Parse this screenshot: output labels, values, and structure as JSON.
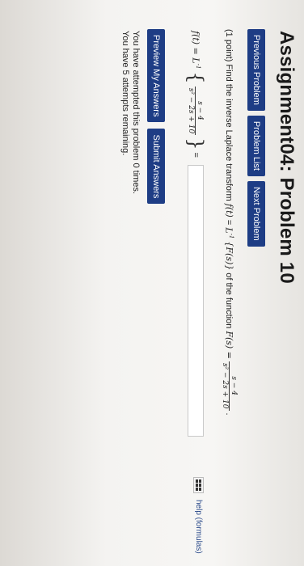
{
  "title": "Assignment04: Problem 10",
  "nav": {
    "previous": "Previous Problem",
    "list": "Problem List",
    "next": "Next Problem"
  },
  "problem": {
    "points": "(1 point)",
    "text": "Find the inverse Laplace transform",
    "ft": "f(t)",
    "equals": "=",
    "linv": "L",
    "inv_sup": "-1",
    "Fs": "{F(s)}",
    "of_fn": "of the function",
    "Fs_eq": "F(s) =",
    "numerator": "s − 4",
    "denominator": "s² − 2s + 10",
    "period": "."
  },
  "equation": {
    "lhs": "f(t) = L",
    "inv_sup": "-1",
    "numerator": "s − 4",
    "denominator": "s² − 2s + 10",
    "equals": "=",
    "answer_value": ""
  },
  "help": {
    "label": "help (formulas)"
  },
  "actions": {
    "preview": "Preview My Answers",
    "submit": "Submit Answers"
  },
  "status": {
    "attempted": "You have attempted this problem 0 times.",
    "remaining": "You have 5 attempts remaining."
  },
  "colors": {
    "button_bg": "#1e3d85",
    "button_text": "#ffffff"
  },
  "icons": {
    "equation_editor": "grid-icon"
  }
}
